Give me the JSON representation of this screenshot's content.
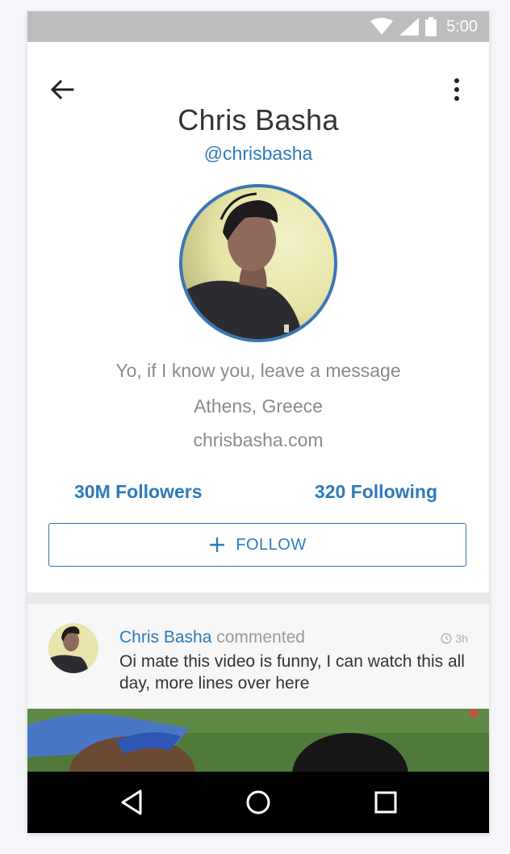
{
  "status_bar": {
    "time": "5:00",
    "icons": [
      "wifi-icon",
      "signal-icon",
      "battery-icon"
    ]
  },
  "toolbar": {
    "back_icon": "arrow-left-icon",
    "menu_icon": "more-vertical-icon"
  },
  "profile": {
    "name": "Chris Basha",
    "handle": "@chrisbasha",
    "bio": "Yo, if I know you, leave a message",
    "location": "Athens, Greece",
    "website": "chrisbasha.com",
    "followers": "30M Followers",
    "following": "320 Following",
    "follow_button": "FOLLOW"
  },
  "feed": {
    "items": [
      {
        "author": "Chris Basha",
        "action": "commented",
        "time": "3h",
        "text": "Oi mate this video is funny, I can watch this all day, more lines over here"
      }
    ]
  },
  "nav": {
    "icons": [
      "back-triangle-icon",
      "home-circle-icon",
      "recents-square-icon"
    ]
  },
  "colors": {
    "accent": "#2d7ab9",
    "status_bar": "#bdbdbd",
    "nav_bar": "#000000"
  }
}
